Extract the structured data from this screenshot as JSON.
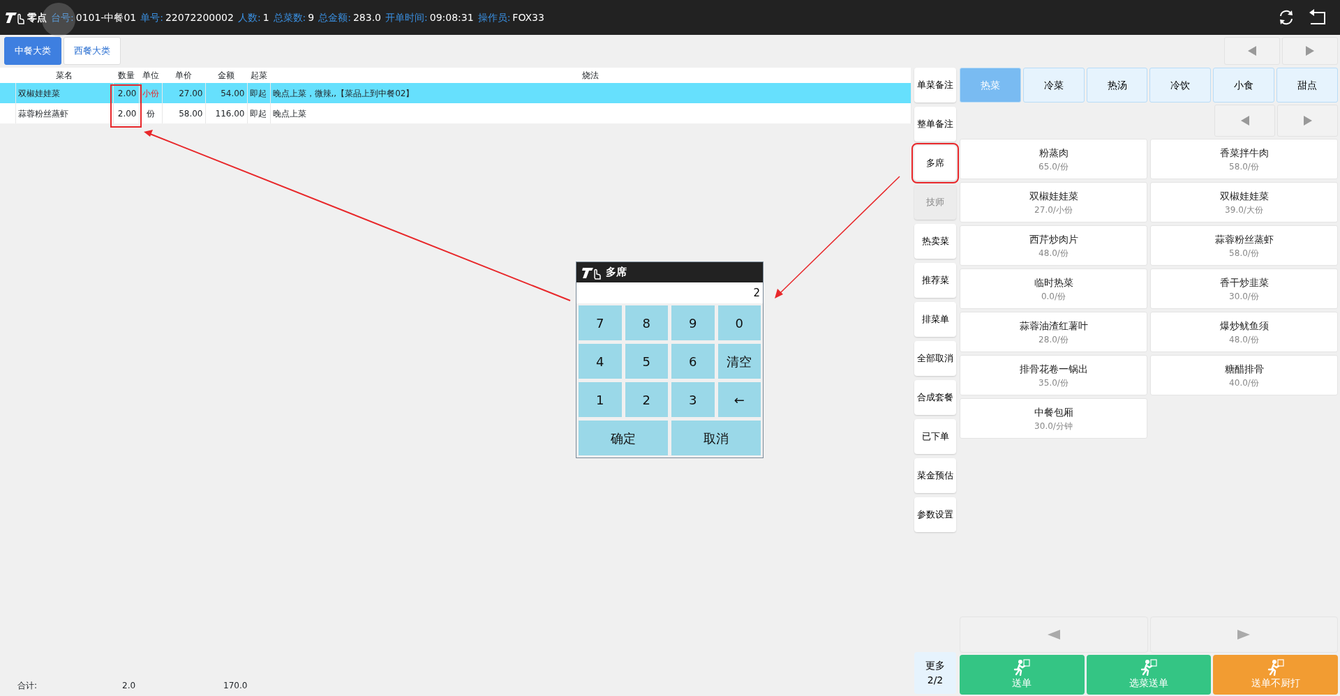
{
  "header": {
    "logo": "零点",
    "fields": [
      {
        "label": "台号:",
        "value": "0101-中餐01"
      },
      {
        "label": "单号:",
        "value": "22072200002"
      },
      {
        "label": "人数:",
        "value": "1"
      },
      {
        "label": "总菜数:",
        "value": "9"
      },
      {
        "label": "总金额:",
        "value": "283.0"
      },
      {
        "label": "开单时间:",
        "value": "09:08:31"
      },
      {
        "label": "操作员:",
        "value": "FOX33"
      }
    ]
  },
  "tabs": [
    {
      "label": "中餐大类",
      "selected": true
    },
    {
      "label": "西餐大类",
      "selected": false
    }
  ],
  "table": {
    "columns": [
      {
        "label": "菜名",
        "highlighted": false
      },
      {
        "label": "数量",
        "highlighted": true
      },
      {
        "label": "单位",
        "highlighted": false
      },
      {
        "label": "单价",
        "highlighted": false
      },
      {
        "label": "金额",
        "highlighted": false
      },
      {
        "label": "起菜",
        "highlighted": false
      },
      {
        "label": "烧法",
        "highlighted": false
      }
    ],
    "rows": [
      {
        "selected": true,
        "special_unit": true,
        "cells": [
          "双椒娃娃菜",
          "2.00",
          "小份",
          "27.00",
          "54.00",
          "即起",
          "晚点上菜，微辣,,【菜品上到中餐02】"
        ]
      },
      {
        "selected": false,
        "special_unit": false,
        "cells": [
          "蒜蓉粉丝蒸虾",
          "2.00",
          "份",
          "58.00",
          "116.00",
          "即起",
          "晚点上菜"
        ]
      }
    ]
  },
  "totals": {
    "label": "合计:",
    "quantity": "2.0",
    "amount": "170.0"
  },
  "function_buttons": [
    {
      "label": "单菜备注",
      "disabled": false,
      "highlighted": false
    },
    {
      "label": "整单备注",
      "disabled": false,
      "highlighted": false
    },
    {
      "label": "多席",
      "disabled": false,
      "highlighted": true
    },
    {
      "label": "技师",
      "disabled": true,
      "highlighted": false
    },
    {
      "label": "热卖菜",
      "disabled": false,
      "highlighted": false
    },
    {
      "label": "推荐菜",
      "disabled": false,
      "highlighted": false
    },
    {
      "label": "排菜单",
      "disabled": false,
      "highlighted": false
    },
    {
      "label": "全部取消",
      "disabled": false,
      "highlighted": false
    },
    {
      "label": "合成套餐",
      "disabled": false,
      "highlighted": false
    },
    {
      "label": "已下单",
      "disabled": false,
      "highlighted": false
    },
    {
      "label": "菜金预估",
      "disabled": false,
      "highlighted": false
    },
    {
      "label": "参数设置",
      "disabled": false,
      "highlighted": false
    }
  ],
  "categories": [
    {
      "label": "热菜",
      "selected": true
    },
    {
      "label": "冷菜",
      "selected": false
    },
    {
      "label": "热汤",
      "selected": false
    },
    {
      "label": "冷饮",
      "selected": false
    },
    {
      "label": "小食",
      "selected": false
    },
    {
      "label": "甜点",
      "selected": false
    }
  ],
  "dishes": [
    {
      "name": "粉蒸肉",
      "price": "65.0/份"
    },
    {
      "name": "香菜拌牛肉",
      "price": "58.0/份"
    },
    {
      "name": "双椒娃娃菜",
      "price": "27.0/小份"
    },
    {
      "name": "双椒娃娃菜",
      "price": "39.0/大份"
    },
    {
      "name": "西芹炒肉片",
      "price": "48.0/份"
    },
    {
      "name": "蒜蓉粉丝蒸虾",
      "price": "58.0/份"
    },
    {
      "name": "临时热菜",
      "price": "0.0/份"
    },
    {
      "name": "香干炒韭菜",
      "price": "30.0/份"
    },
    {
      "name": "蒜蓉油渣红薯叶",
      "price": "28.0/份"
    },
    {
      "name": "爆炒鱿鱼须",
      "price": "48.0/份"
    },
    {
      "name": "排骨花卷一锅出",
      "price": "35.0/份"
    },
    {
      "name": "糖醋排骨",
      "price": "40.0/份"
    },
    {
      "name": "中餐包厢",
      "price": "30.0/分钟"
    }
  ],
  "more": {
    "label": "更多",
    "page": "2/2"
  },
  "actions": [
    {
      "label": "送单",
      "color": "#34c584"
    },
    {
      "label": "选菜送单",
      "color": "#34c584"
    },
    {
      "label": "送单不厨打",
      "color": "#f29c32"
    }
  ],
  "dialog": {
    "title": "多席",
    "value": "2",
    "keys": [
      "7",
      "8",
      "9",
      "0",
      "4",
      "5",
      "6",
      "清空",
      "1",
      "2",
      "3",
      "←"
    ],
    "buttons": [
      "确定",
      "取消"
    ]
  }
}
